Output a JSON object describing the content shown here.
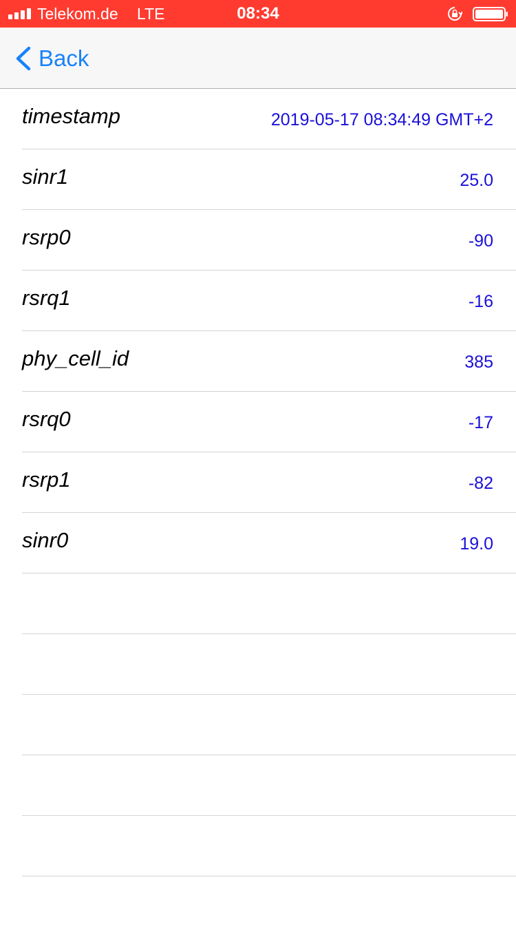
{
  "status_bar": {
    "carrier": "Telekom.de",
    "network": "LTE",
    "time": "08:34",
    "background_color": "#ff3b30"
  },
  "nav": {
    "back_label": "Back",
    "accent_color": "#1a82fb"
  },
  "rows": [
    {
      "key": "timestamp",
      "value": "2019-05-17 08:34:49 GMT+2"
    },
    {
      "key": "sinr1",
      "value": "25.0"
    },
    {
      "key": "rsrp0",
      "value": "-90"
    },
    {
      "key": "rsrq1",
      "value": "-16"
    },
    {
      "key": "phy_cell_id",
      "value": "385"
    },
    {
      "key": "rsrq0",
      "value": "-17"
    },
    {
      "key": "rsrp1",
      "value": "-82"
    },
    {
      "key": "sinr0",
      "value": "19.0"
    },
    {
      "key": "",
      "value": ""
    },
    {
      "key": "",
      "value": ""
    },
    {
      "key": "",
      "value": ""
    },
    {
      "key": "",
      "value": ""
    },
    {
      "key": "",
      "value": ""
    },
    {
      "key": "",
      "value": ""
    }
  ]
}
